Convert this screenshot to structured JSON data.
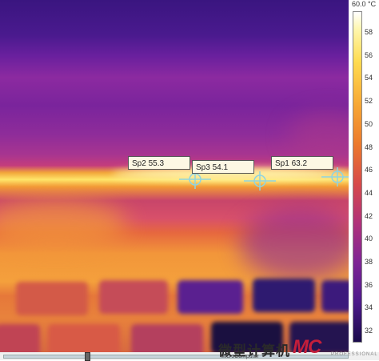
{
  "scale": {
    "max_label": "60.0 °C",
    "ticks": [
      "58",
      "56",
      "54",
      "52",
      "50",
      "48",
      "46",
      "44",
      "42",
      "40",
      "38",
      "36",
      "34",
      "32"
    ]
  },
  "spots": [
    {
      "label": "Sp2 55.3"
    },
    {
      "label": "Sp3 54.1"
    },
    {
      "label": "Sp1 63.2"
    }
  ],
  "watermark": {
    "title": "微型计算机",
    "subtitle": "MicroComputer",
    "logo": "MC",
    "logo_sub": "PROFESSIONAL"
  },
  "colors": {
    "marker": "#8fd4e0",
    "label_bg": "#fdf8e4"
  }
}
